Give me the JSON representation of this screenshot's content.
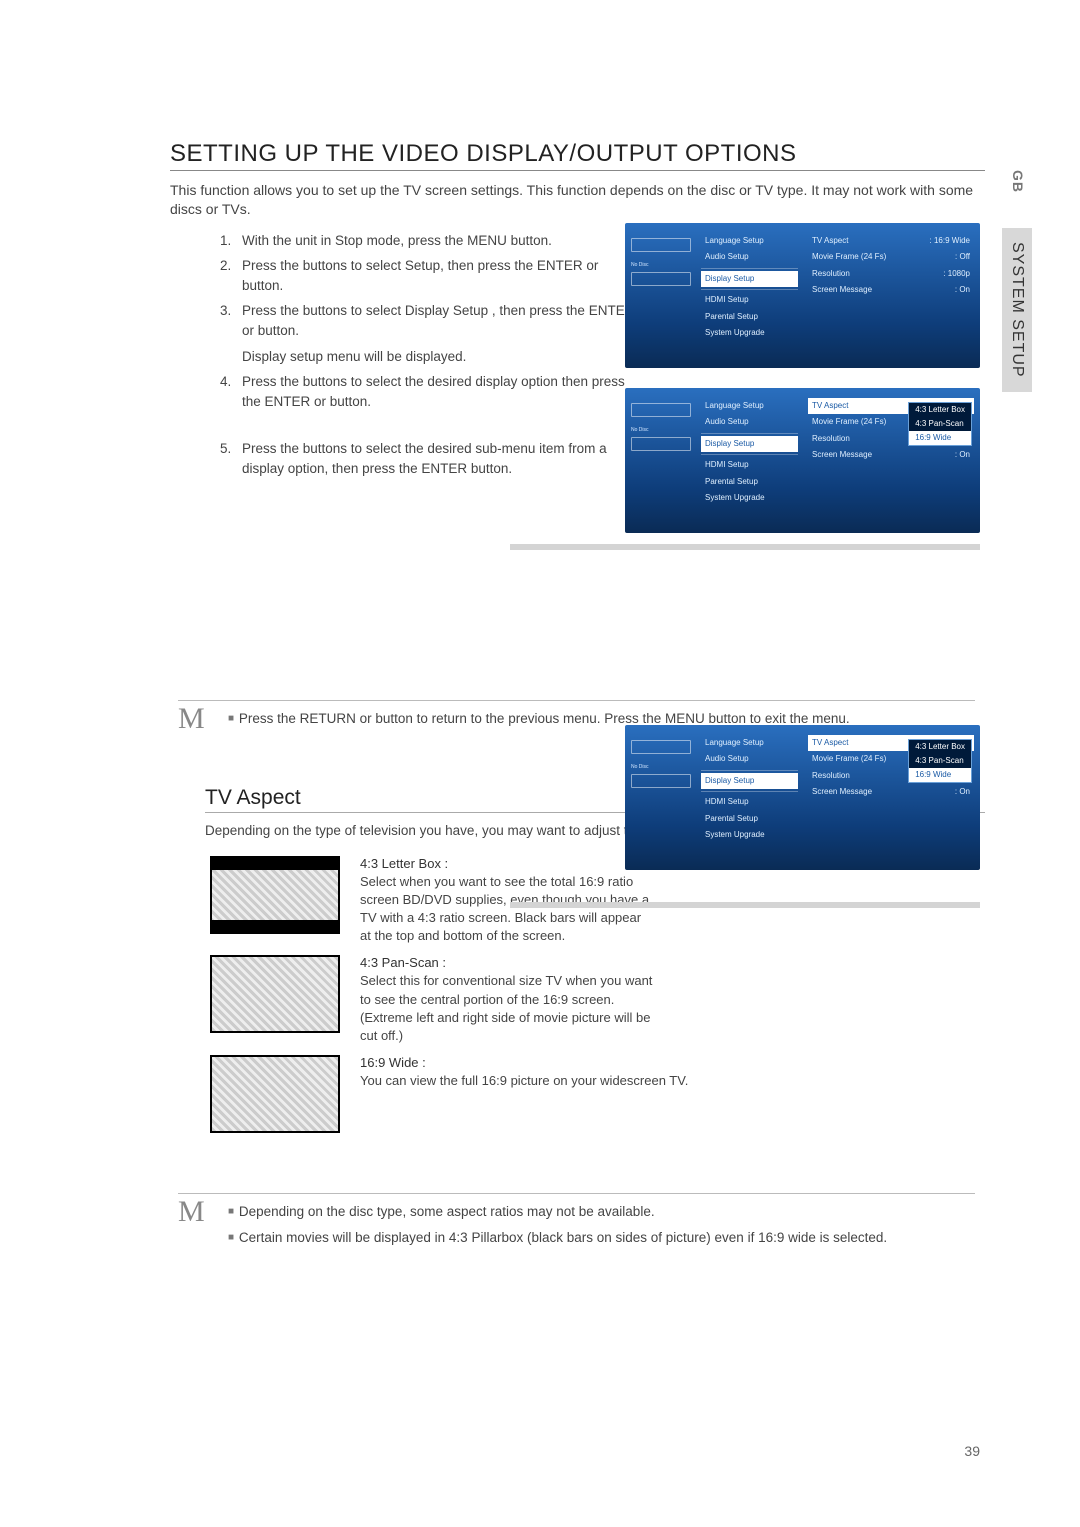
{
  "sideTabs": {
    "gb": "GB",
    "section": "SYSTEM SETUP"
  },
  "title": "SETTING UP THE VIDEO DISPLAY/OUTPUT OPTIONS",
  "intro": "This function allows you to set up the TV screen settings. This function depends on the disc or TV type. It may not work with some discs or TVs.",
  "steps": {
    "s1": "With the unit in Stop mode, press the MENU button.",
    "s2": "Press the       buttons to select Setup, then press the ENTER or       button.",
    "s3a": "Press the       buttons to select Display Setup , then press the ENTER or       button.",
    "s3b": "Display setup menu will be displayed.",
    "s4": "Press the       buttons to select the desired display option then press the ENTER or       button.",
    "s5": "Press the       buttons to select the desired sub-menu item from a display option, then press the ENTER button."
  },
  "menu": {
    "noDisc": "No Disc",
    "items": {
      "language": "Language Setup",
      "audio": "Audio Setup",
      "display": "Display Setup",
      "hdmi": "HDMI Setup",
      "parental": "Parental Setup",
      "upgrade": "System Upgrade"
    },
    "options": {
      "tvAspect": "TV Aspect",
      "movieFrame": "Movie Frame (24 Fs)",
      "resolution": "Resolution",
      "screenMsg": "Screen Message"
    },
    "values": {
      "tvAspect": ": 16:9 Wide",
      "movieFrame": ": Off",
      "resolution": ": 1080p",
      "screenMsg": ": On"
    },
    "dropdown": {
      "o1": "4:3 Letter Box",
      "o2": "4:3 Pan-Scan",
      "o3": "16:9 Wide"
    }
  },
  "note1": "Press the RETURN or       button to return to the previous menu. Press the MENU button to exit the menu.",
  "tvAspect": {
    "title": "TV Aspect",
    "intro": "Depending on the type of television you have, you may want to adjust the screen setting. (aspect ratio)",
    "letterbox": {
      "title": "4:3 Letter Box :",
      "body": "Select when you want to see the total 16:9 ratio screen BD/DVD supplies, even though you have a TV with a 4:3 ratio screen. Black bars will appear at the top and bottom of the screen."
    },
    "panscan": {
      "title": "4:3 Pan-Scan :",
      "body": "Select this for conventional size TV when you want to see the central portion of the 16:9 screen. (Extreme left and right side of movie picture will be cut off.)"
    },
    "wide": {
      "title": "16:9 Wide :",
      "body": "You can view the full 16:9 picture on your widescreen TV."
    }
  },
  "note2a": "Depending on the disc type, some aspect ratios may not be available.",
  "note2b": "Certain movies will be displayed in 4:3 Pillarbox (black bars on sides of picture) even if 16:9 wide is selected.",
  "pageNum": "39"
}
